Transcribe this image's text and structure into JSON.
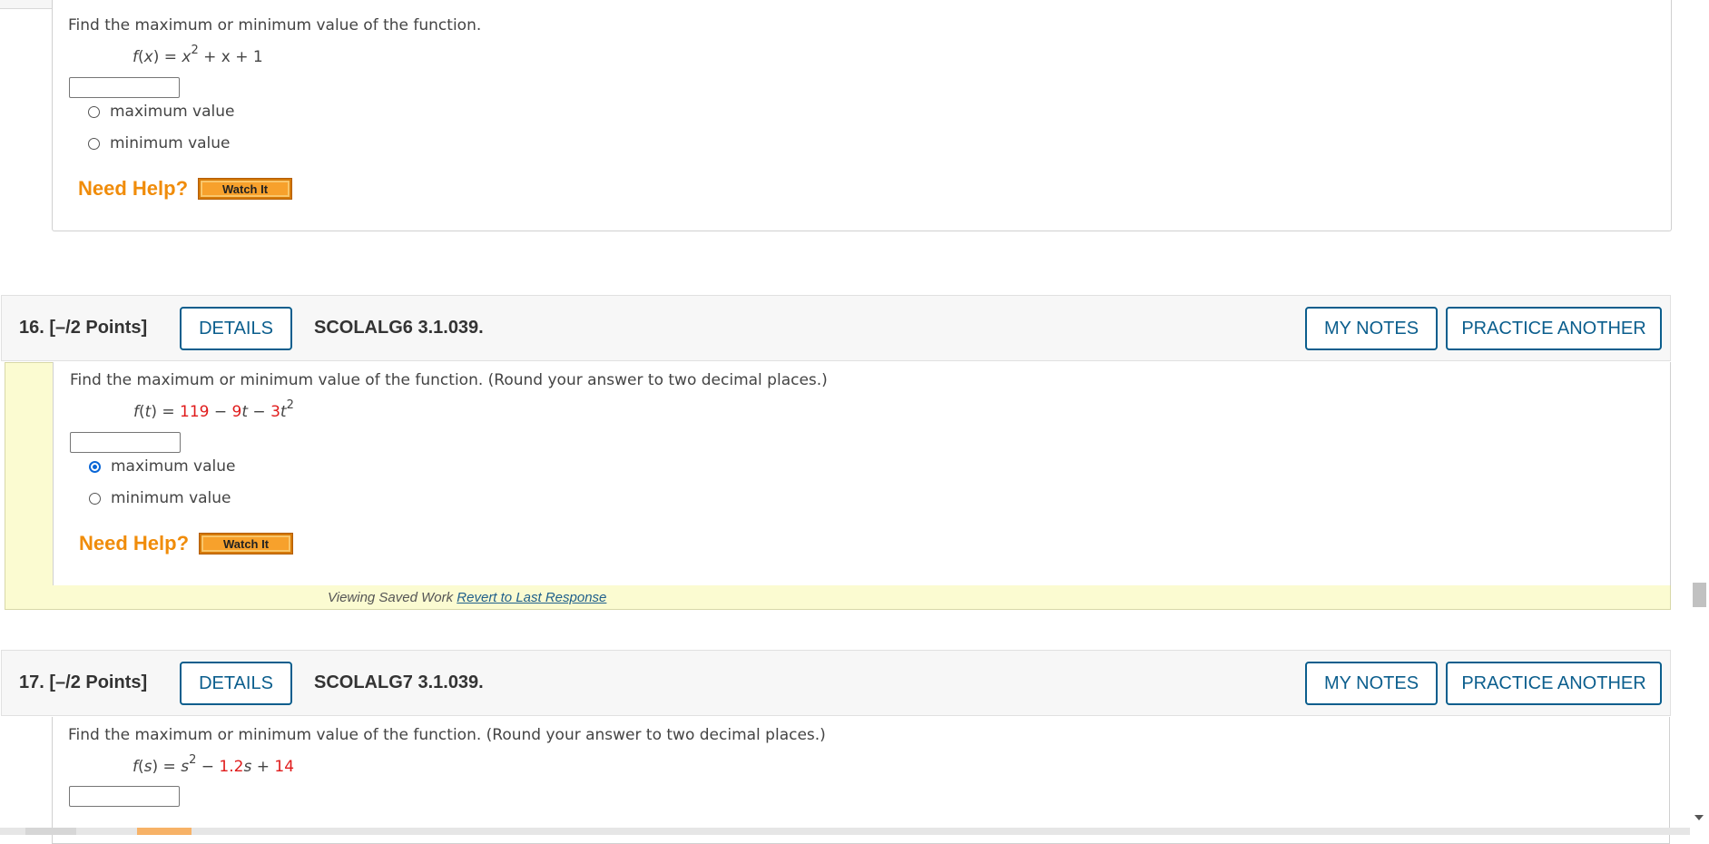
{
  "q15": {
    "prompt": "Find the maximum or minimum value of the function.",
    "function": {
      "lhs_name": "f",
      "lhs_var": "x",
      "eq": " = ",
      "t1": "x",
      "t1_exp": "2",
      "rest": " + x + 1"
    },
    "answer_value": "",
    "options": [
      {
        "label": "maximum value",
        "selected": false
      },
      {
        "label": "minimum value",
        "selected": false
      }
    ],
    "need_help": "Need Help?",
    "watch_it": "Watch It"
  },
  "q16": {
    "number": "16.  [–/2 Points]",
    "details": "DETAILS",
    "code": "SCOLALG6 3.1.039.",
    "my_notes": "MY NOTES",
    "practice": "PRACTICE ANOTHER",
    "prompt": "Find the maximum or minimum value of the function. (Round your answer to two decimal places.)",
    "function": {
      "lhs_name": "f",
      "lhs_var": "t",
      "eq": " = ",
      "c0": "119",
      "op1": " − ",
      "c1": "9",
      "v1": "t",
      "op2": " − ",
      "c2": "3",
      "v2": "t",
      "exp2": "2"
    },
    "answer_value": "",
    "options": [
      {
        "label": "maximum value",
        "selected": true
      },
      {
        "label": "minimum value",
        "selected": false
      }
    ],
    "need_help": "Need Help?",
    "watch_it": "Watch It",
    "saved_work": "Viewing Saved Work ",
    "revert": "Revert to Last Response"
  },
  "q17": {
    "number": "17.  [–/2 Points]",
    "details": "DETAILS",
    "code": "SCOLALG7 3.1.039.",
    "my_notes": "MY NOTES",
    "practice": "PRACTICE ANOTHER",
    "prompt": "Find the maximum or minimum value of the function. (Round your answer to two decimal places.)",
    "function": {
      "lhs_name": "f",
      "lhs_var": "s",
      "eq": " = ",
      "t1": "s",
      "t1_exp": "2",
      "op1": " − ",
      "c1": "1.2",
      "v1": "s",
      "op2": " + ",
      "c2": "14"
    },
    "answer_value": ""
  },
  "colors": {
    "accent_blue": "#0b5e8d",
    "need_help_orange": "#f08c0a",
    "value_red": "#e01b1b",
    "saved_yellow": "#fbfbd1"
  }
}
